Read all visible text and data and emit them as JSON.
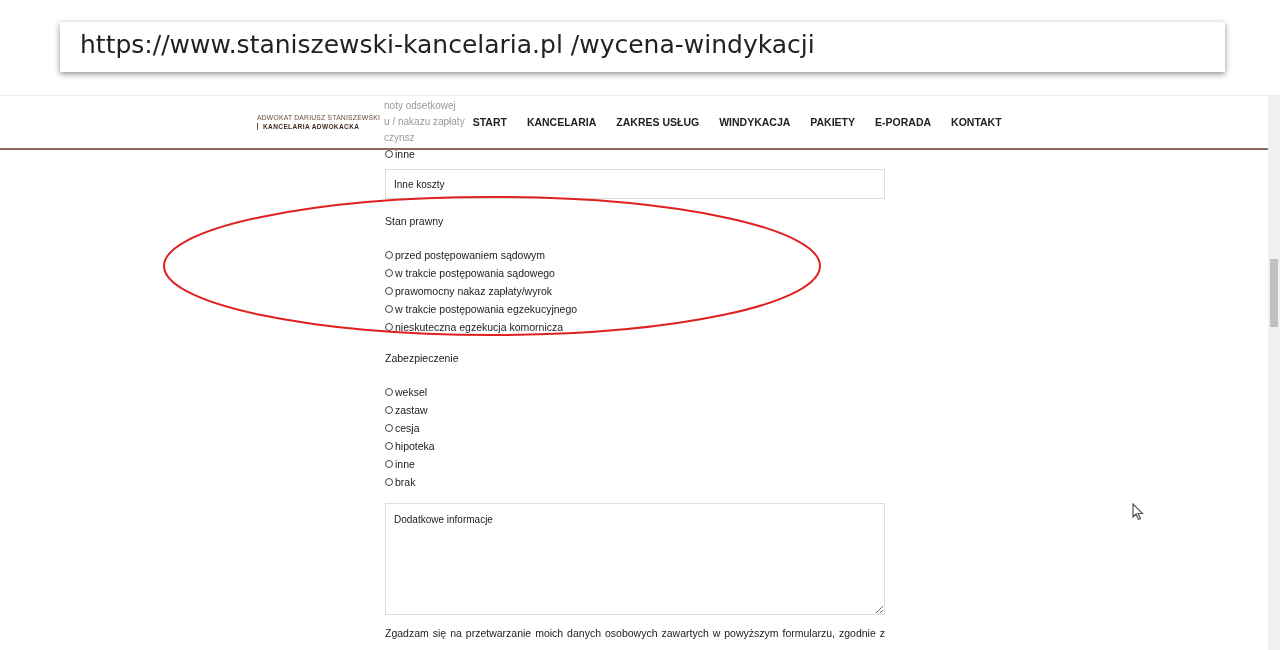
{
  "address_bar": {
    "url": "https://www.staniszewski-kancelaria.pl /wycena-windykacji"
  },
  "header": {
    "logo": {
      "line_1": "ADWOKAT DARIUSZ STANISZEWSKI",
      "line_2": "KANCELARIA ADWOKACKA"
    },
    "behind_header_items": [
      "noty odsetkowej",
      "u / nakazu zapłaty",
      "czynsz"
    ],
    "nav": [
      {
        "label": "START"
      },
      {
        "label": "KANCELARIA"
      },
      {
        "label": "ZAKRES USŁUG"
      },
      {
        "label": "WINDYKACJA"
      },
      {
        "label": "PAKIETY"
      },
      {
        "label": "E-PORADA"
      },
      {
        "label": "KONTAKT"
      }
    ]
  },
  "form": {
    "top_options": [
      {
        "label": "inne",
        "selected": false
      }
    ],
    "other_costs": {
      "placeholder": "Inne koszty"
    },
    "groups": [
      {
        "title": "Stan prawny",
        "highlighted": true,
        "options": [
          {
            "label": "przed postępowaniem sądowym",
            "selected": false
          },
          {
            "label": "w trakcie postępowania sądowego",
            "selected": false
          },
          {
            "label": "prawomocny nakaz zapłaty/wyrok",
            "selected": false
          },
          {
            "label": "w trakcie postępowania egzekucyjnego",
            "selected": false
          },
          {
            "label": "nieskuteczna egzekucja komornicza",
            "selected": false
          }
        ]
      },
      {
        "title": "Zabezpieczenie",
        "highlighted": false,
        "options": [
          {
            "label": "weksel",
            "selected": false
          },
          {
            "label": "zastaw",
            "selected": false
          },
          {
            "label": "cesja",
            "selected": false
          },
          {
            "label": "hipoteka",
            "selected": false
          },
          {
            "label": "inne",
            "selected": false
          },
          {
            "label": "brak",
            "selected": false
          }
        ]
      }
    ],
    "additional_info": {
      "placeholder": "Dodatkowe informacje"
    },
    "consent": "Zgadzam się na przetwarzanie moich danych osobowych zawartych w powyższym formularzu, zgodnie z"
  }
}
